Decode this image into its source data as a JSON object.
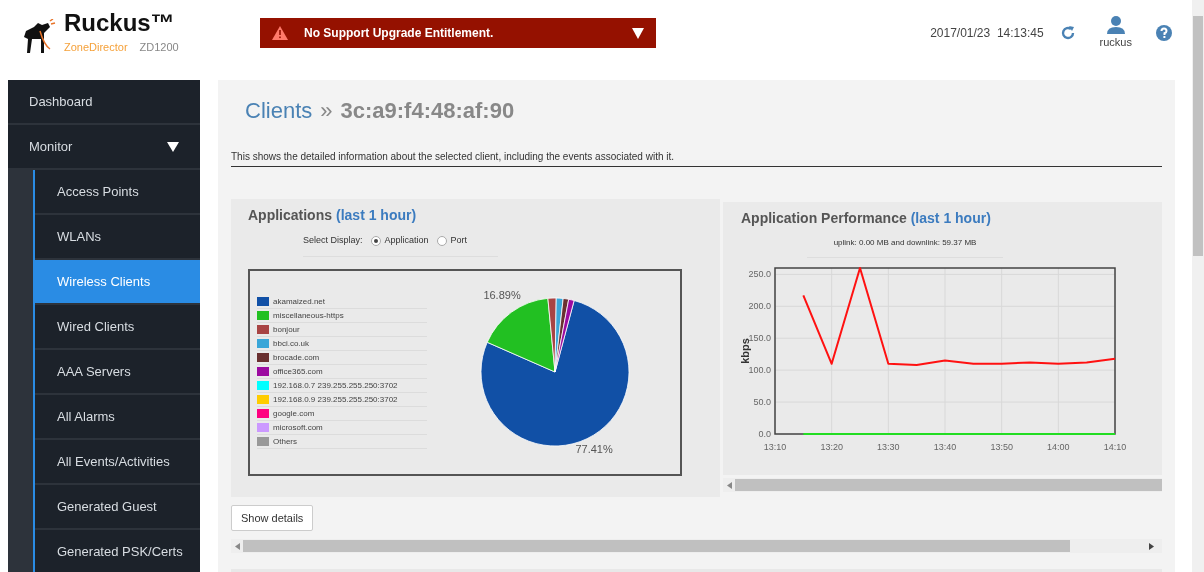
{
  "header": {
    "brand": "Ruckus™",
    "product": "ZoneDirector",
    "model": "ZD1200",
    "alert": {
      "text": "No Support Upgrade Entitlement.",
      "expanded": false
    },
    "datetime": "2017/01/23  14:13:45",
    "user": "ruckus"
  },
  "sidebar": {
    "items": [
      {
        "label": "Dashboard",
        "selected": false
      },
      {
        "label": "Monitor",
        "selected": false,
        "expanded": true,
        "children": [
          {
            "label": "Access Points",
            "selected": false
          },
          {
            "label": "WLANs",
            "selected": false
          },
          {
            "label": "Wireless Clients",
            "selected": true
          },
          {
            "label": "Wired Clients",
            "selected": false
          },
          {
            "label": "AAA Servers",
            "selected": false
          },
          {
            "label": "All Alarms",
            "selected": false
          },
          {
            "label": "All Events/Activities",
            "selected": false
          },
          {
            "label": "Generated Guest",
            "selected": false
          },
          {
            "label": "Generated PSK/Certs",
            "selected": false
          }
        ]
      }
    ]
  },
  "page": {
    "title": "Clients",
    "separator": "»",
    "subject": "3c:a9:f4:48:af:90",
    "description": "This shows the detailed information about the selected client, including the events associated with it."
  },
  "applications": {
    "title": "Applications",
    "period": "(last 1 hour)",
    "select_label": "Select Display:",
    "options": [
      {
        "label": "Application",
        "selected": true
      },
      {
        "label": "Port",
        "selected": false
      }
    ],
    "legend": [
      {
        "color": "#1150a6"
      },
      {
        "color": "#22c022"
      },
      {
        "color": "#a84444"
      },
      {
        "color": "#3aa6d8"
      },
      {
        "color": "#6a3030"
      },
      {
        "color": "#9c0aa0"
      },
      {
        "color": "#00ffff"
      },
      {
        "color": "#ffcc00"
      },
      {
        "color": "#ff0080"
      },
      {
        "color": "#cc99ff"
      },
      {
        "color": "#999999"
      }
    ],
    "chart_data": {
      "type": "pie",
      "categories": [
        "akamaized.net",
        "miscellaneous-https",
        "bonjour",
        "bbci.co.uk",
        "brocade.com",
        "office365.com",
        "192.168.0.7 239.255.255.250:3702",
        "192.168.0.9 239.255.255.250:3702",
        "google.com",
        "microsoft.com",
        "Others"
      ],
      "values": [
        77.41,
        16.89,
        1.8,
        1.5,
        1.2,
        1.2,
        null,
        null,
        null,
        null,
        null
      ],
      "value_labels": [
        "77.41%",
        "16.89%",
        null,
        null,
        null,
        null,
        null,
        null,
        null,
        null,
        null
      ]
    }
  },
  "performance": {
    "title": "Application Performance",
    "period": "(last 1 hour)",
    "summary": "uplink: 0.00 MB and downlink: 59.37 MB",
    "chart_data": {
      "type": "line",
      "ylabel": "kbps",
      "x": [
        795,
        800,
        805,
        810,
        815,
        820,
        825,
        830,
        835,
        840,
        845,
        850
      ],
      "xlim": [
        790,
        850
      ],
      "ylim": [
        0,
        260
      ],
      "grid": true,
      "xticks": [
        {
          "value": 790,
          "label": "13:10"
        },
        {
          "value": 800,
          "label": "13:20"
        },
        {
          "value": 810,
          "label": "13:30"
        },
        {
          "value": 820,
          "label": "13:40"
        },
        {
          "value": 830,
          "label": "13:50"
        },
        {
          "value": 840,
          "label": "14:00"
        },
        {
          "value": 850,
          "label": "14:10"
        }
      ],
      "yticks": [
        {
          "value": 0,
          "label": "0.0"
        },
        {
          "value": 50,
          "label": "50.0"
        },
        {
          "value": 100,
          "label": "100.0"
        },
        {
          "value": 150,
          "label": "150.0"
        },
        {
          "value": 200,
          "label": "200.0"
        },
        {
          "value": 250,
          "label": "250.0"
        }
      ],
      "series": [
        {
          "color": "#22dd22",
          "values": [
            0,
            0,
            0,
            0,
            0,
            0,
            0,
            0,
            0,
            0,
            0,
            0
          ]
        },
        {
          "color": "#ff1111",
          "values": [
            217,
            110,
            260,
            110,
            108,
            115,
            110,
            110,
            112,
            110,
            112,
            118
          ]
        }
      ]
    }
  },
  "details_button": "Show details"
}
